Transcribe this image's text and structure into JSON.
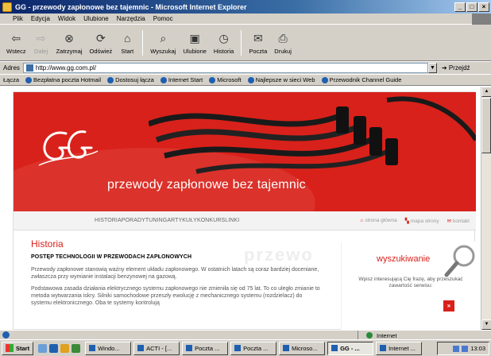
{
  "window": {
    "title": "GG - przewody zapłonowe bez tajemnic - Microsoft Internet Explorer",
    "buttons": [
      "_",
      "□",
      "×"
    ]
  },
  "menu": [
    "Plik",
    "Edycja",
    "Widok",
    "Ulubione",
    "Narzędzia",
    "Pomoc"
  ],
  "toolbar": [
    {
      "label": "Wstecz",
      "icon": "back-arrow-icon",
      "enabled": true
    },
    {
      "label": "Dalej",
      "icon": "forward-arrow-icon",
      "enabled": false
    },
    {
      "label": "Zatrzymaj",
      "icon": "stop-icon",
      "enabled": true
    },
    {
      "label": "Odśwież",
      "icon": "refresh-icon",
      "enabled": true
    },
    {
      "label": "Start",
      "icon": "home-icon",
      "enabled": true
    },
    {
      "label": "Wyszukaj",
      "icon": "search-icon",
      "enabled": true
    },
    {
      "label": "Ulubione",
      "icon": "favorites-icon",
      "enabled": true
    },
    {
      "label": "Historia",
      "icon": "history-icon",
      "enabled": true
    },
    {
      "label": "Poczta",
      "icon": "mail-icon",
      "enabled": true
    },
    {
      "label": "Drukuj",
      "icon": "print-icon",
      "enabled": true
    }
  ],
  "address": {
    "label": "Adres",
    "url": "http://www.gg.com.pl/",
    "go_label": "Przejdź"
  },
  "links": {
    "label": "Łącza",
    "items": [
      "Bezpłatna poczta Hotmail",
      "Dostosuj łącza",
      "Internet Start",
      "Microsoft",
      "Najlepsze w sieci Web",
      "Przewodnik Channel Guide"
    ]
  },
  "page": {
    "tagline": "przewody zapłonowe bez tajemnic",
    "nav_links": "HISTORIAPORADYTUNINGARTYKUŁYKONKURSLINKI",
    "util_links": [
      "strona główna",
      "mapa strony",
      "kontakt"
    ],
    "heading": "Historia",
    "subheading": "POSTĘP TECHNOLOGII W PRZEWODACH ZAPŁONOWYCH",
    "paragraphs": [
      "Przewody zapłonowe stanowią ważny element układu zapłonowego. W ostatnich latach są coraz bardziej doceniane, zwłaszcza przy wymianie instalacji benzynowej na gazową.",
      "Podstawowa zasada działania elektrycznego systemu zapłonowego nie zmieniła się od 75 lat. To co uległo zmianie to metoda wytwarzania iskry. Silniki samochodowe przeszły ewolucję z mechanicznego systemu (rozdzielacz) do systemu elektronicznego. Oba te systemy kontrolują"
    ],
    "watermark": "przewo",
    "search": {
      "title": "wyszukiwanie",
      "text": "Wpisz interesującą Cię frazę, aby przeszukać zawartość serwisu:",
      "button": "»"
    }
  },
  "status": {
    "left": "",
    "zone": "Internet"
  },
  "taskbar": {
    "start": "Start",
    "tasks": [
      "Windo...",
      "ACTI - [...",
      "Poczta ...",
      "Poczta ...",
      "Microso...",
      "GG - ...",
      "Internet ..."
    ],
    "active_index": 5,
    "clock": "13:03"
  },
  "colors": {
    "brand_red": "#d8211a",
    "titlebar": "#0a246a",
    "chrome": "#d4d0c8"
  }
}
